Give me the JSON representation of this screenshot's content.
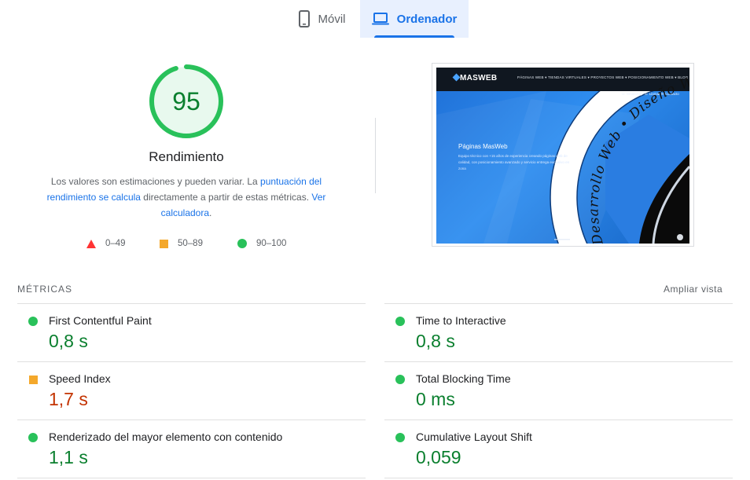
{
  "tabs": [
    {
      "label": "Móvil",
      "icon": "smartphone-icon",
      "active": false
    },
    {
      "label": "Ordenador",
      "icon": "laptop-icon",
      "active": true
    }
  ],
  "summary": {
    "score": "95",
    "score_value": 95,
    "title": "Rendimiento",
    "desc_1": "Los valores son estimaciones y pueden variar. La ",
    "desc_link_1": "puntuación del rendimiento se calcula",
    "desc_2": " directamente a partir de estas métricas. ",
    "desc_link_2": "Ver calculadora",
    "desc_3": "."
  },
  "legend": [
    {
      "label": "0–49",
      "shape": "triangle",
      "color": "#ff3333"
    },
    {
      "label": "50–89",
      "shape": "square",
      "color": "#f4a82b"
    },
    {
      "label": "90–100",
      "shape": "circle",
      "color": "#29c15a"
    }
  ],
  "thumbnail": {
    "logo": "MASWEB",
    "nav": "PÁGINAS WEB ▾   TIENDAS VIRTUALES ▾   PROYECTOS WEB ▾   POSICIONAMIENTO WEB ▾   BLOG",
    "sub": "☏ WhatsApp   ☏ Llamar   ✉ Contacto",
    "headline": "Páginas MasWeb",
    "text": "Equipo técnico con +15 años de experiencia creando páginas web de calidad, con posicionamiento avanzado y servicio entrega exclusivo en zona",
    "badge_text": "Desarrollo Web • Diseño Web •"
  },
  "metrics": {
    "title": "MÉTRICAS",
    "expand_label": "Ampliar vista",
    "items": [
      {
        "name": "First Contentful Paint",
        "value": "0,8 s",
        "status": "good"
      },
      {
        "name": "Time to Interactive",
        "value": "0,8 s",
        "status": "good"
      },
      {
        "name": "Speed Index",
        "value": "1,7 s",
        "status": "average"
      },
      {
        "name": "Total Blocking Time",
        "value": "0 ms",
        "status": "good"
      },
      {
        "name": "Renderizado del mayor elemento con contenido",
        "value": "1,1 s",
        "status": "good"
      },
      {
        "name": "Cumulative Layout Shift",
        "value": "0,059",
        "status": "good"
      }
    ]
  },
  "colors": {
    "accent": "#1a73e8",
    "good": "#0a7f2e",
    "good_indicator": "#29c15a",
    "average": "#c33300",
    "average_indicator": "#f4a82b",
    "fail": "#ff3333"
  }
}
